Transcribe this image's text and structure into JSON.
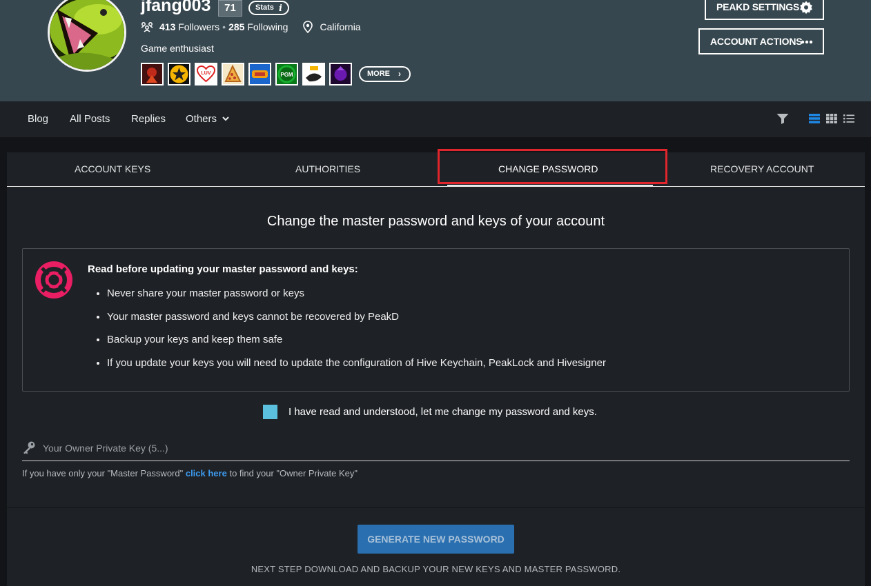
{
  "profile": {
    "username": "jfang003",
    "reputation": "71",
    "stats_label": "Stats",
    "followers_count": "413",
    "followers_label": "Followers",
    "following_count": "285",
    "following_label": "Following",
    "location": "California",
    "bio": "Game enthusiast",
    "badges": [
      "badge-1",
      "badge-2",
      "badge-luv",
      "badge-pizza",
      "badge-5",
      "badge-pgm",
      "badge-7",
      "badge-8"
    ],
    "badge_texts": {
      "luv": "LUV",
      "pgm": "PGM"
    },
    "more_label": "MORE"
  },
  "header_actions": {
    "peakd_settings": "PEAKD SETTINGS",
    "account_actions": "ACCOUNT ACTIONS"
  },
  "nav": {
    "items": [
      "Blog",
      "All Posts",
      "Replies",
      "Others"
    ]
  },
  "tabs": [
    "ACCOUNT KEYS",
    "AUTHORITIES",
    "CHANGE PASSWORD",
    "RECOVERY ACCOUNT"
  ],
  "active_tab": "CHANGE PASSWORD",
  "change_password": {
    "heading": "Change the master password and keys of your account",
    "notice_title": "Read before updating your master password and keys:",
    "bullets": [
      "Never share your master password or keys",
      "Your master password and keys cannot be recovered by PeakD",
      "Backup your keys and keep them safe",
      "If you update your keys you will need to update the configuration of Hive Keychain, PeakLock and Hivesigner"
    ],
    "agree_label": "I have read and understood, let me change my password and keys.",
    "agree_checked": true,
    "key_placeholder": "Your Owner Private Key (5...)",
    "key_value": "",
    "helper_before": "If you have only your \"Master Password\" ",
    "helper_link": "click here",
    "helper_after": " to find your \"Owner Private Key\"",
    "generate_button": "GENERATE NEW PASSWORD",
    "next_step": "NEXT STEP DOWNLOAD AND BACKUP YOUR NEW KEYS AND MASTER PASSWORD."
  },
  "colors": {
    "header_bg": "#37474f",
    "panel_bg": "#1e2125",
    "highlight_box": "#e0252c",
    "checkbox": "#5bc0de",
    "primary_button": "#2a6fb0",
    "link": "#3d9bf0",
    "lifebuoy": "#e91e63",
    "view_active": "#1e88e5"
  }
}
